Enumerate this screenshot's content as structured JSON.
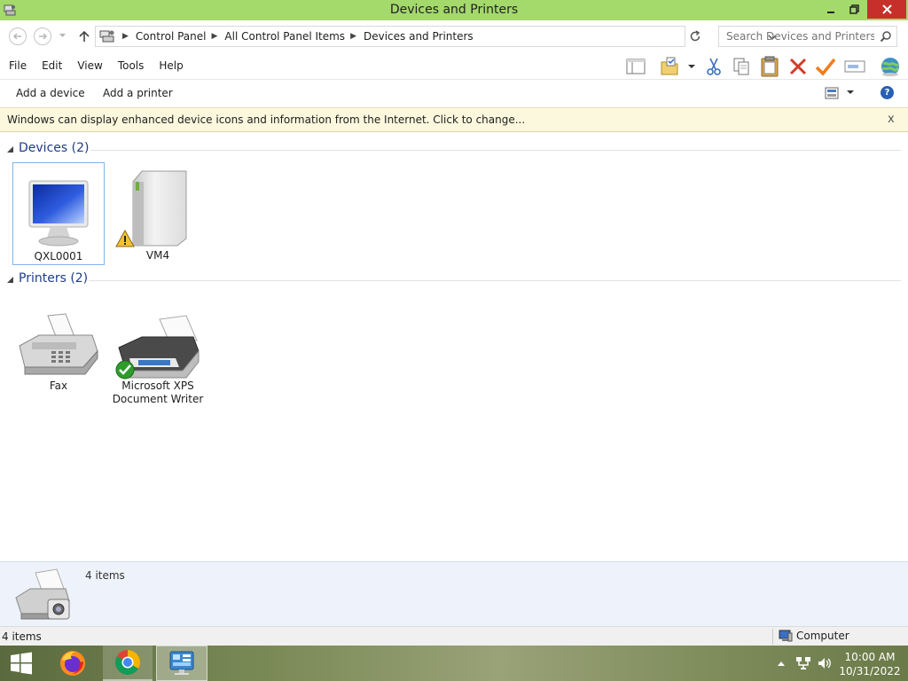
{
  "window": {
    "title": "Devices and Printers"
  },
  "address": {
    "breadcrumbs": [
      "Control Panel",
      "All Control Panel Items",
      "Devices and Printers"
    ]
  },
  "search": {
    "placeholder": "Search Devices and Printers"
  },
  "menu": {
    "items": [
      "File",
      "Edit",
      "View",
      "Tools",
      "Help"
    ]
  },
  "commands": {
    "add_device": "Add a device",
    "add_printer": "Add a printer"
  },
  "infobar": {
    "message": "Windows can display enhanced device icons and information from the Internet. Click to change...",
    "close": "x"
  },
  "groups": {
    "devices": {
      "label": "Devices (2)",
      "items": [
        {
          "name": "QXL0001",
          "icon": "monitor-icon",
          "selected": true
        },
        {
          "name": "VM4",
          "icon": "computer-tower-icon",
          "warning": true
        }
      ]
    },
    "printers": {
      "label": "Printers (2)",
      "items": [
        {
          "name": "Fax",
          "icon": "fax-icon"
        },
        {
          "name": "Microsoft XPS\nDocument Writer",
          "name_line1": "Microsoft XPS",
          "name_line2": "Document Writer",
          "icon": "printer-icon",
          "default": true
        }
      ]
    }
  },
  "details": {
    "count": "4 items"
  },
  "status": {
    "items": "4 items",
    "zone": "Computer"
  },
  "taskbar": {
    "time": "10:00 AM",
    "date": "10/31/2022"
  },
  "colors": {
    "titlebar": "#a4d96c",
    "close_button": "#c7302a",
    "group_header": "#1e3d87",
    "infobar_bg": "#fcf8dd",
    "details_bg": "#eef2fa"
  }
}
